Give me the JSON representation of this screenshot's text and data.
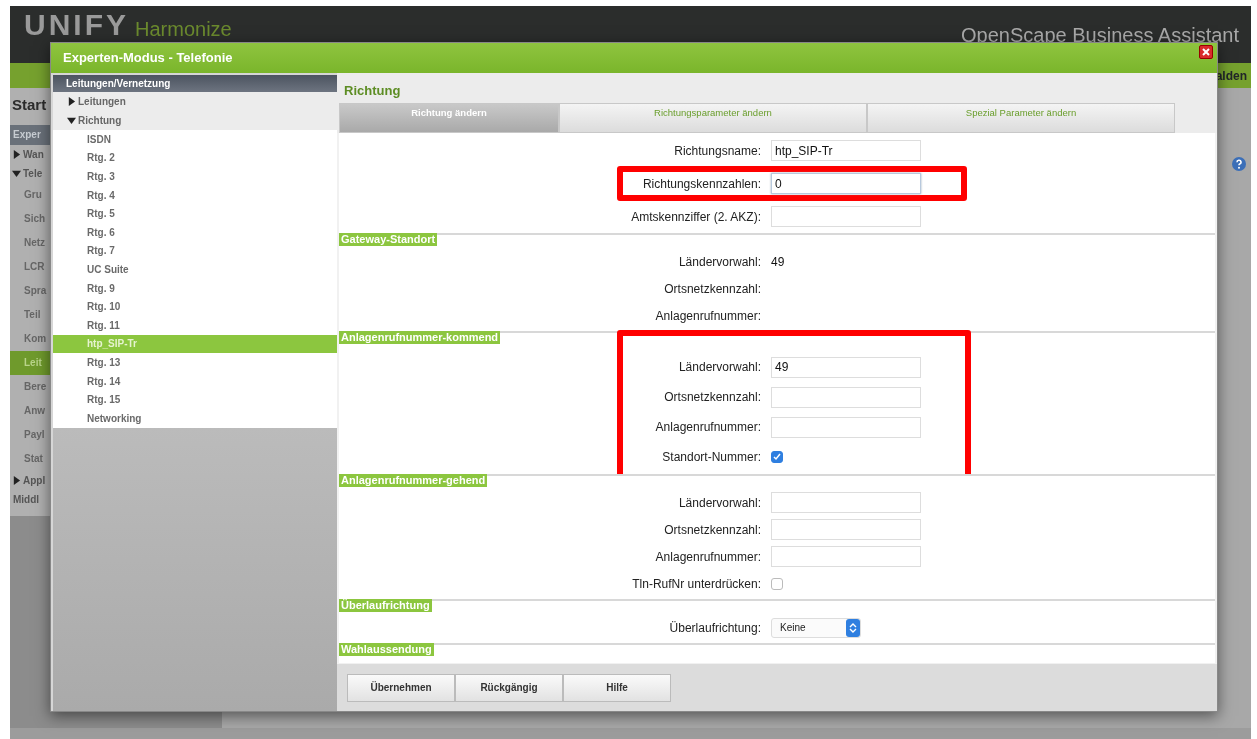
{
  "background": {
    "logo": {
      "wordmark": "UNIFY",
      "tagline": "Harmonize"
    },
    "product_title": "OpenScape Business Assistant",
    "link_fragment": "alden",
    "page_heading": "Start",
    "sidebar": [
      {
        "label": "Exper",
        "kind": "header"
      },
      {
        "label": "Wan",
        "kind": "toggle",
        "expanded": false
      },
      {
        "label": "Tele",
        "kind": "toggle",
        "expanded": true
      },
      {
        "label": "Gru",
        "kind": "item",
        "selected": false
      },
      {
        "label": "Sich",
        "kind": "item",
        "selected": false
      },
      {
        "label": "Netz",
        "kind": "item",
        "selected": false
      },
      {
        "label": "LCR",
        "kind": "item",
        "selected": false
      },
      {
        "label": "Spra",
        "kind": "item",
        "selected": false
      },
      {
        "label": "Teil",
        "kind": "item",
        "selected": false
      },
      {
        "label": "Kom",
        "kind": "item",
        "selected": false
      },
      {
        "label": "Leit",
        "kind": "item",
        "selected": true
      },
      {
        "label": "Bere",
        "kind": "item",
        "selected": false
      },
      {
        "label": "Anw",
        "kind": "item",
        "selected": false
      },
      {
        "label": "Payl",
        "kind": "item",
        "selected": false
      },
      {
        "label": "Stat",
        "kind": "item",
        "selected": false
      },
      {
        "label": "Appl",
        "kind": "toggle",
        "expanded": false
      },
      {
        "label": "Middl",
        "kind": "plain"
      }
    ]
  },
  "dialog": {
    "title": "Experten-Modus - Telefonie",
    "tree": {
      "header": "Leitungen/Vernetzung",
      "nodes": [
        {
          "label": "Leitungen",
          "expanded": false
        },
        {
          "label": "Richtung",
          "expanded": true,
          "children": [
            {
              "label": "ISDN",
              "selected": false
            },
            {
              "label": "Rtg. 2",
              "selected": false
            },
            {
              "label": "Rtg. 3",
              "selected": false
            },
            {
              "label": "Rtg. 4",
              "selected": false
            },
            {
              "label": "Rtg. 5",
              "selected": false
            },
            {
              "label": "Rtg. 6",
              "selected": false
            },
            {
              "label": "Rtg. 7",
              "selected": false
            },
            {
              "label": "UC Suite",
              "selected": false
            },
            {
              "label": "Rtg. 9",
              "selected": false
            },
            {
              "label": "Rtg. 10",
              "selected": false
            },
            {
              "label": "Rtg. 11",
              "selected": false
            },
            {
              "label": "htp_SIP-Tr",
              "selected": true
            },
            {
              "label": "Rtg. 13",
              "selected": false
            },
            {
              "label": "Rtg. 14",
              "selected": false
            },
            {
              "label": "Rtg. 15",
              "selected": false
            },
            {
              "label": "Networking",
              "selected": false
            }
          ]
        }
      ]
    },
    "panel_title": "Richtung",
    "tabs": [
      {
        "label": "Richtung ändern",
        "selected": true
      },
      {
        "label": "Richtungsparameter ändern",
        "selected": false
      },
      {
        "label": "Spezial Parameter ändern",
        "selected": false
      }
    ],
    "sections": [
      {
        "rows": [
          {
            "kind": "input",
            "label": "Richtungsname:",
            "value": "htp_SIP-Tr"
          },
          {
            "kind": "input",
            "label": "Richtungskennzahlen:",
            "value": "0",
            "highlighted": true
          },
          {
            "kind": "input",
            "label": "Amtskennziffer (2. AKZ):"
          }
        ]
      },
      {
        "title": "Gateway-Standort",
        "rows": [
          {
            "kind": "text",
            "label": "Ländervorwahl:",
            "value": "49"
          },
          {
            "kind": "text",
            "label": "Ortsnetzkennzahl:"
          },
          {
            "kind": "text",
            "label": "Anlagenrufnummer:"
          }
        ]
      },
      {
        "title": "Anlagenrufnummer-kommend",
        "highlighted": true,
        "rows": [
          {
            "kind": "input",
            "label": "Ländervorwahl:",
            "value": "49"
          },
          {
            "kind": "input",
            "label": "Ortsnetzkennzahl:"
          },
          {
            "kind": "input",
            "label": "Anlagenrufnummer:"
          },
          {
            "kind": "checkbox",
            "label": "Standort-Nummer:",
            "checked": true
          }
        ]
      },
      {
        "title": "Anlagenrufnummer-gehend",
        "rows": [
          {
            "kind": "input",
            "label": "Ländervorwahl:"
          },
          {
            "kind": "input",
            "label": "Ortsnetzkennzahl:"
          },
          {
            "kind": "input",
            "label": "Anlagenrufnummer:"
          },
          {
            "kind": "checkbox",
            "label": "Tln-RufNr unterdrücken:",
            "checked": false
          }
        ]
      },
      {
        "title": "Überlaufrichtung",
        "rows": [
          {
            "kind": "select",
            "label": "Überlaufrichtung:",
            "value": "Keine"
          }
        ]
      },
      {
        "title": "Wahlaussendung"
      }
    ],
    "buttons": [
      "Übernehmen",
      "Rückgängig",
      "Hilfe"
    ]
  }
}
